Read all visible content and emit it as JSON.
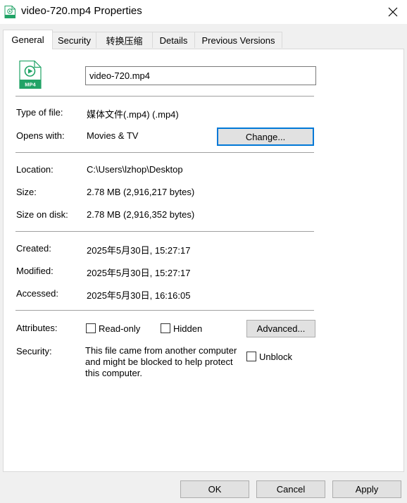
{
  "window": {
    "title": "video-720.mp4 Properties",
    "file_badge": "MP4"
  },
  "tabs": [
    {
      "label": "General",
      "active": true
    },
    {
      "label": "Security",
      "active": false
    },
    {
      "label": "转换压缩",
      "active": false
    },
    {
      "label": "Details",
      "active": false
    },
    {
      "label": "Previous Versions",
      "active": false
    }
  ],
  "general": {
    "file_name": "video-720.mp4",
    "type_of_file_label": "Type of file:",
    "type_of_file": "媒体文件(.mp4) (.mp4)",
    "opens_with_label": "Opens with:",
    "opens_with": "Movies & TV",
    "change_button": "Change...",
    "location_label": "Location:",
    "location": "C:\\Users\\lzhop\\Desktop",
    "size_label": "Size:",
    "size": "2.78 MB (2,916,217 bytes)",
    "size_on_disk_label": "Size on disk:",
    "size_on_disk": "2.78 MB (2,916,352 bytes)",
    "created_label": "Created:",
    "created": "2025年5月30日, 15:27:17",
    "modified_label": "Modified:",
    "modified": "2025年5月30日, 15:27:17",
    "accessed_label": "Accessed:",
    "accessed": "2025年5月30日, 16:16:05",
    "attributes_label": "Attributes:",
    "read_only_label": "Read-only",
    "read_only_checked": false,
    "hidden_label": "Hidden",
    "hidden_checked": false,
    "advanced_button": "Advanced...",
    "security_label": "Security:",
    "security_text": "This file came from another computer and might be blocked to help protect this computer.",
    "unblock_label": "Unblock",
    "unblock_checked": false
  },
  "footer": {
    "ok": "OK",
    "cancel": "Cancel",
    "apply": "Apply"
  },
  "colors": {
    "icon_green": "#21a366",
    "focus_blue": "#0078d7",
    "button_face": "#e1e1e1"
  },
  "icons": {
    "file": "mp4-file-icon",
    "close": "close-icon"
  }
}
